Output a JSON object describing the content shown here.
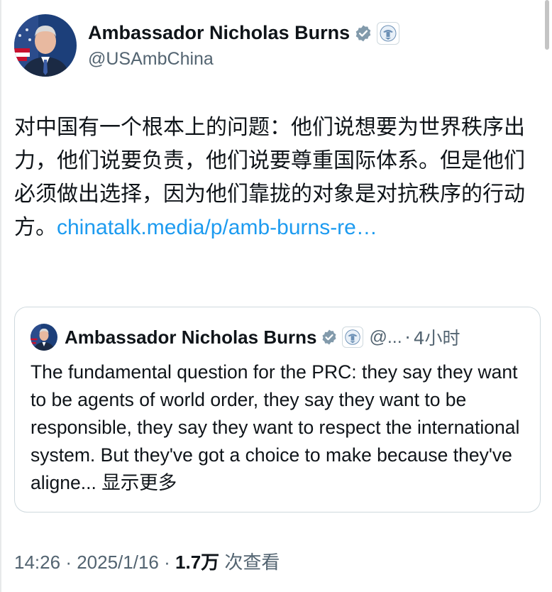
{
  "author": {
    "name": "Ambassador Nicholas Burns",
    "handle": "@USAmbChina",
    "avatar_icon": "avatar-photo-icon",
    "verified_icon": "verified-badge-icon",
    "affiliation_icon": "us-government-seal-icon",
    "badge_color": "#829aab"
  },
  "tweet": {
    "text": "对中国有一个根本上的问题：他们说想要为世界秩序出力，他们说要负责，他们说要尊重国际体系。但是他们必须做出选择，因为他们靠拢的对象是对抗秩序的行动方。",
    "link": "chinatalk.media/p/amb-burns-re…",
    "link_color": "#1d9bf0"
  },
  "quote": {
    "name": "Ambassador Nicholas Burns",
    "handle": "@...",
    "separator": "·",
    "time": "4小时",
    "text": "The fundamental question for the PRC: they say they want to be agents of world order, they say they want to be responsible, they say they want to respect the international system. But they've got a choice to make because they've aligne...",
    "show_more": "显示更多"
  },
  "meta": {
    "time": "14:26",
    "sep1": "·",
    "date": "2025/1/16",
    "sep2": "·",
    "views_count": "1.7万",
    "views_label": "次查看"
  }
}
